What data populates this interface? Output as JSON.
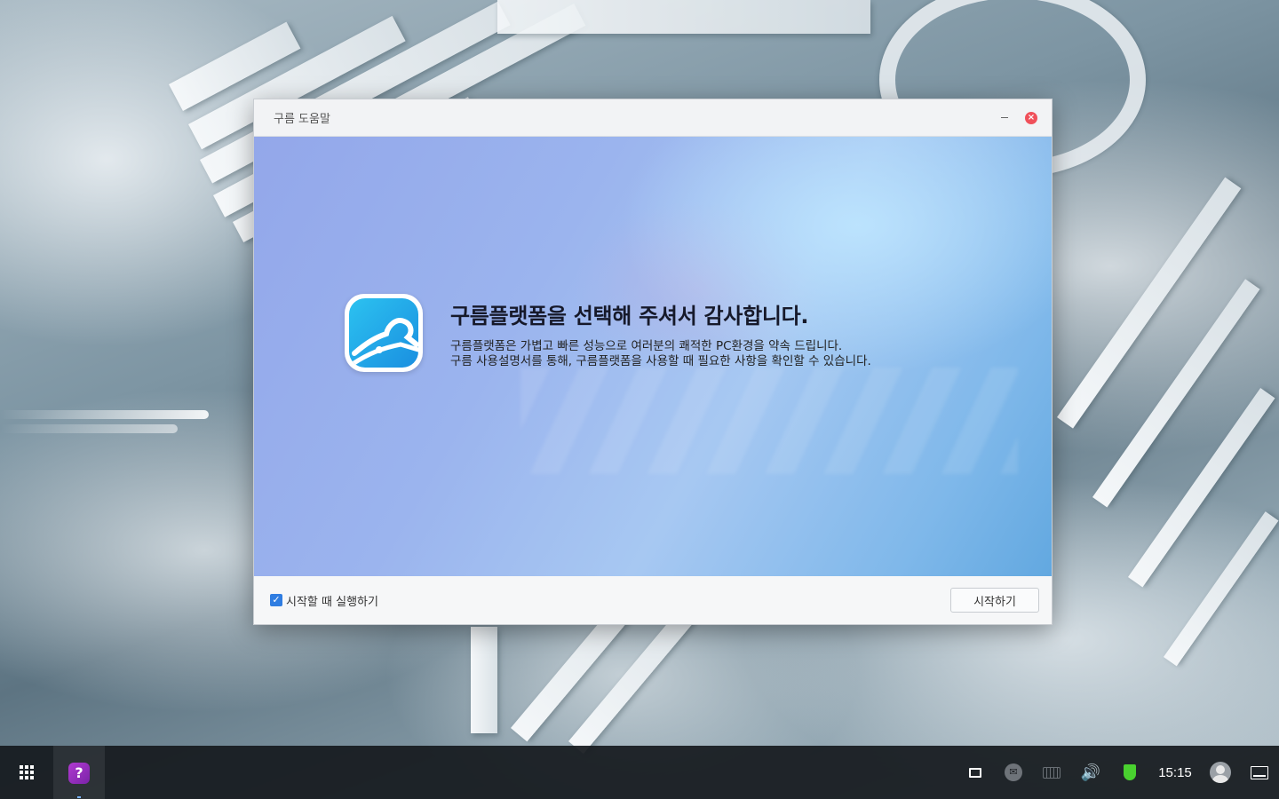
{
  "window": {
    "title": "구름 도움말",
    "minimize_label": "–",
    "close_label": "×"
  },
  "hero": {
    "title": "구름플랫폼을 선택해 주셔서 감사합니다.",
    "desc_line1": "구름플랫폼은 가볍고 빠른 성능으로 여러분의 쾌적한 PC환경을 약속 드립니다.",
    "desc_line2": "구름 사용설명서를 통해, 구름플랫폼을 사용할 때 필요한 사항을 확인할 수 있습니다."
  },
  "footer": {
    "checkbox_checked": true,
    "checkbox_mark": "✓",
    "checkbox_label": "시작할 때 실행하기",
    "start_button": "시작하기"
  },
  "taskbar": {
    "help_app_glyph": "?",
    "mail_glyph": "✉",
    "volume_glyph": "🔊",
    "clock": "15:15",
    "icons": [
      "launcher-icon",
      "help-app-icon",
      "notification-icon",
      "mail-icon",
      "keyboard-icon",
      "volume-icon",
      "security-shield-icon",
      "user-icon",
      "show-desktop-icon"
    ]
  },
  "colors": {
    "accent": "#2f7de1",
    "close_button": "#f0505a",
    "security_green": "#49d12f",
    "help_app": "#9a2fc0"
  }
}
